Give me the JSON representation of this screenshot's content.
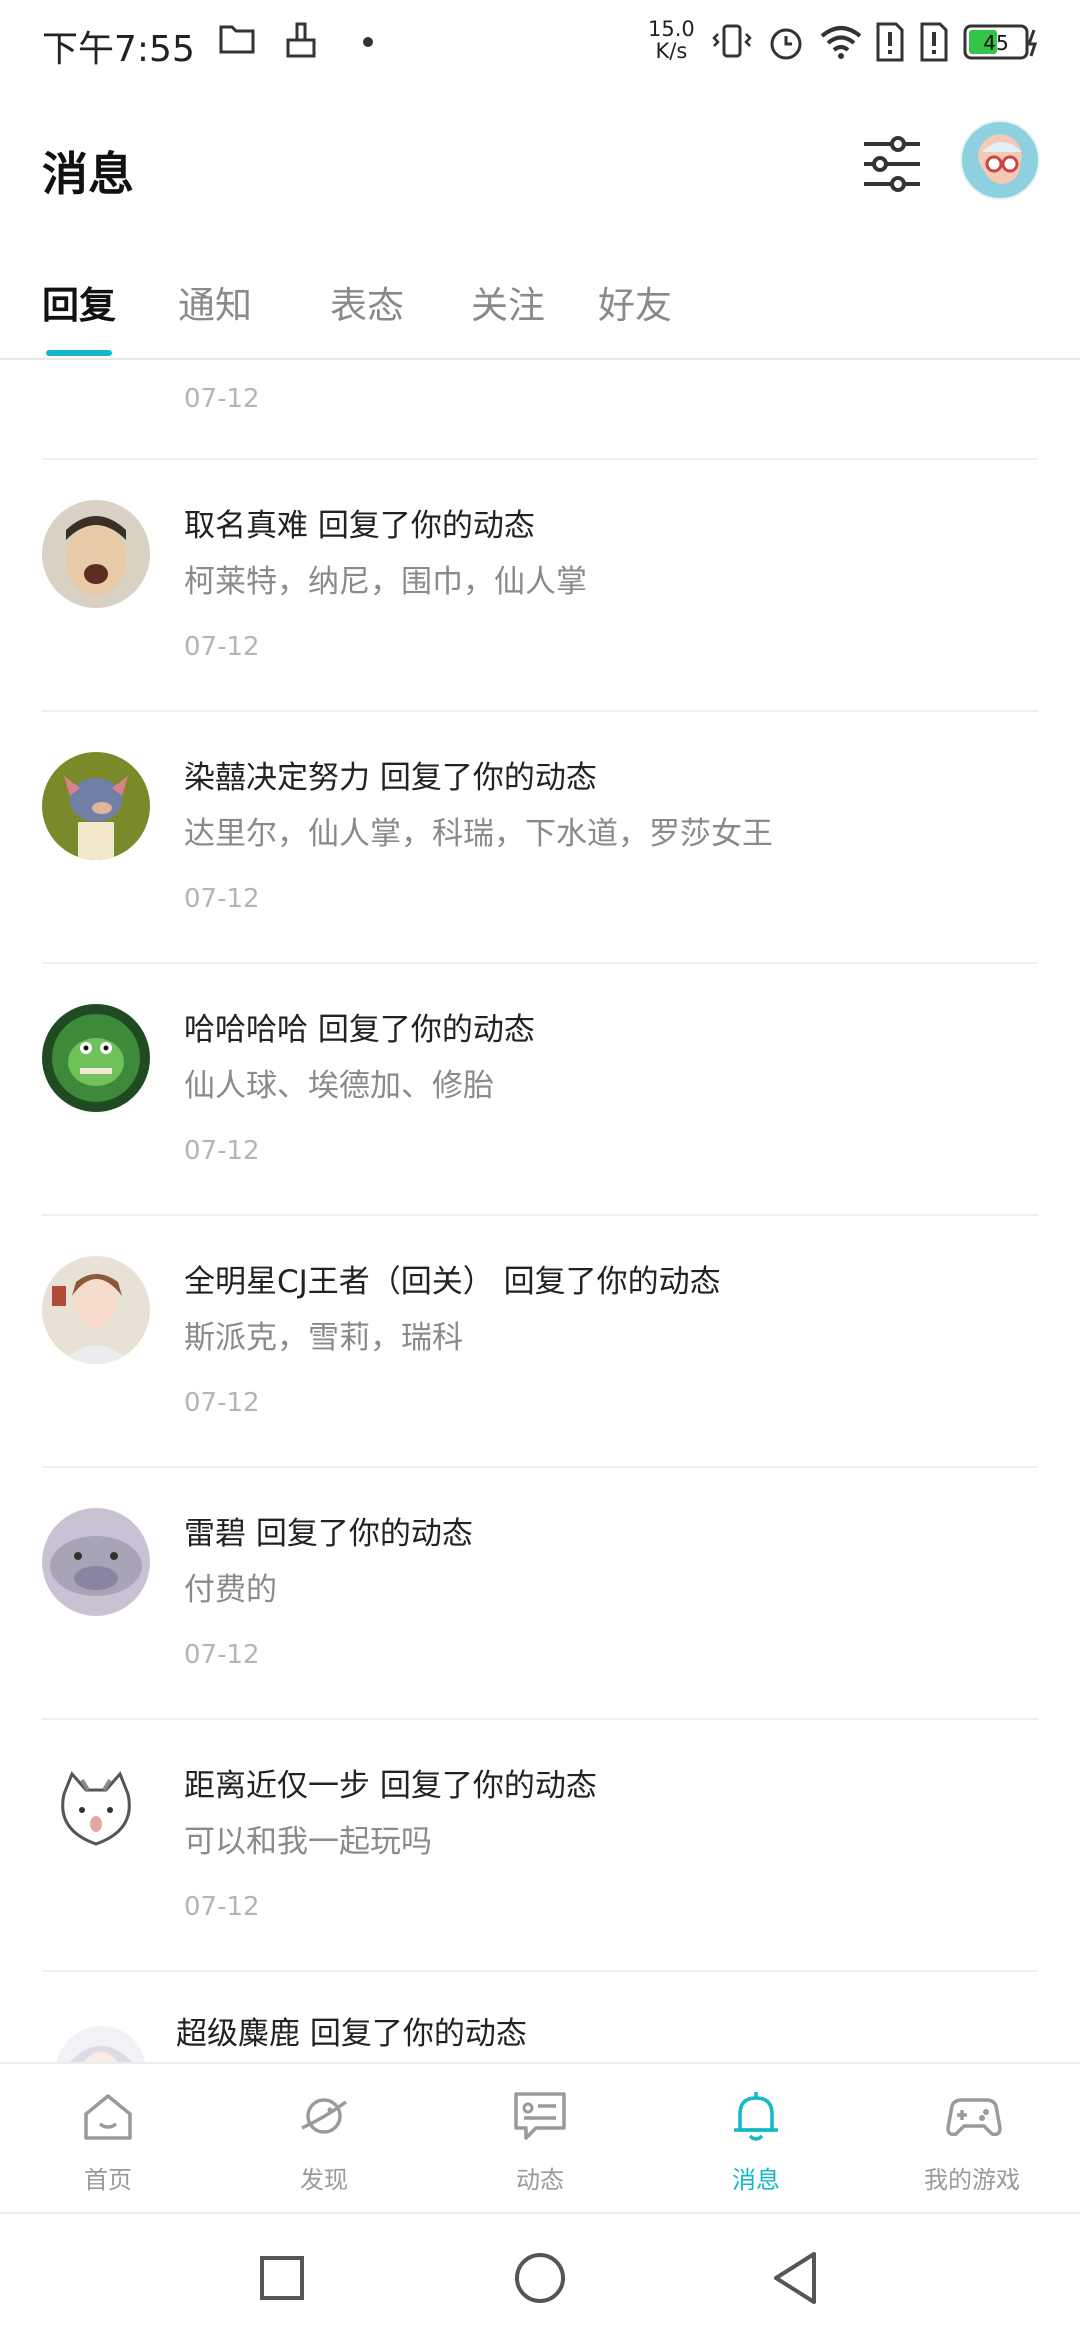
{
  "status_bar": {
    "time": "下午7:55",
    "speed_value": "15.0",
    "speed_unit": "K/s",
    "battery": "45"
  },
  "header": {
    "title": "消息"
  },
  "tabs": [
    {
      "label": "回复",
      "active": true
    },
    {
      "label": "通知",
      "active": false
    },
    {
      "label": "表态",
      "active": false
    },
    {
      "label": "关注",
      "active": false
    },
    {
      "label": "好友",
      "active": false
    }
  ],
  "list": {
    "leading_date": "07-12",
    "items": [
      {
        "title": "取名真难 回复了你的动态",
        "subtitle": "柯莱特，纳尼，围巾，仙人掌",
        "date": "07-12"
      },
      {
        "title": "染囍决定努力 回复了你的动态",
        "subtitle": "达里尔，仙人掌，科瑞，下水道，罗莎女王",
        "date": "07-12"
      },
      {
        "title": "哈哈哈哈 回复了你的动态",
        "subtitle": "仙人球、埃德加、修胎",
        "date": "07-12"
      },
      {
        "title": "全明星CJ王者（回关） 回复了你的动态",
        "subtitle": "斯派克，雪莉，瑞科",
        "date": "07-12"
      },
      {
        "title": "雷碧 回复了你的动态",
        "subtitle": "付费的",
        "date": "07-12"
      },
      {
        "title": "距离近仅一步 回复了你的动态",
        "subtitle": "可以和我一起玩吗",
        "date": "07-12"
      },
      {
        "title": "超级麋鹿 回复了你的动态",
        "subtitle": "",
        "date": ""
      }
    ]
  },
  "bottom_nav": [
    {
      "label": "首页",
      "icon": "home-icon",
      "active": false
    },
    {
      "label": "发现",
      "icon": "planet-icon",
      "active": false
    },
    {
      "label": "动态",
      "icon": "feed-icon",
      "active": false
    },
    {
      "label": "消息",
      "icon": "bell-icon",
      "active": true
    },
    {
      "label": "我的游戏",
      "icon": "gamepad-icon",
      "active": false
    }
  ],
  "colors": {
    "accent": "#14b9c8",
    "muted_text": "#8a8a8a",
    "date_text": "#b5b5b5"
  }
}
